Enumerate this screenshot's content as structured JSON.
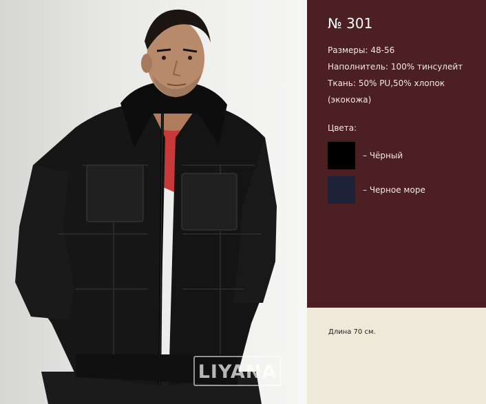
{
  "product": {
    "model": "№ 301",
    "sizes": "Размеры: 48-56",
    "filling": "Наполнитель:  100% тинсулейт",
    "fabric_line1": "Ткань: 50% PU,50% хлопок",
    "fabric_line2": "(экокожа)",
    "colors_title": "Цвета:",
    "colors": [
      {
        "label": "– Чёрный",
        "hex": "#000000"
      },
      {
        "label": "– Черное море",
        "hex": "#1e2238"
      }
    ],
    "length_note": "Длина 70 см."
  },
  "photo": {
    "watermark": "LIYANA",
    "jacket_color": "#141414",
    "shirt_color": "#c8393a",
    "skin_color": "#b88a6c",
    "hair_color": "#1c1512"
  },
  "theme": {
    "panel_bg": "#4c1f22",
    "page_bg": "#efe9da"
  }
}
